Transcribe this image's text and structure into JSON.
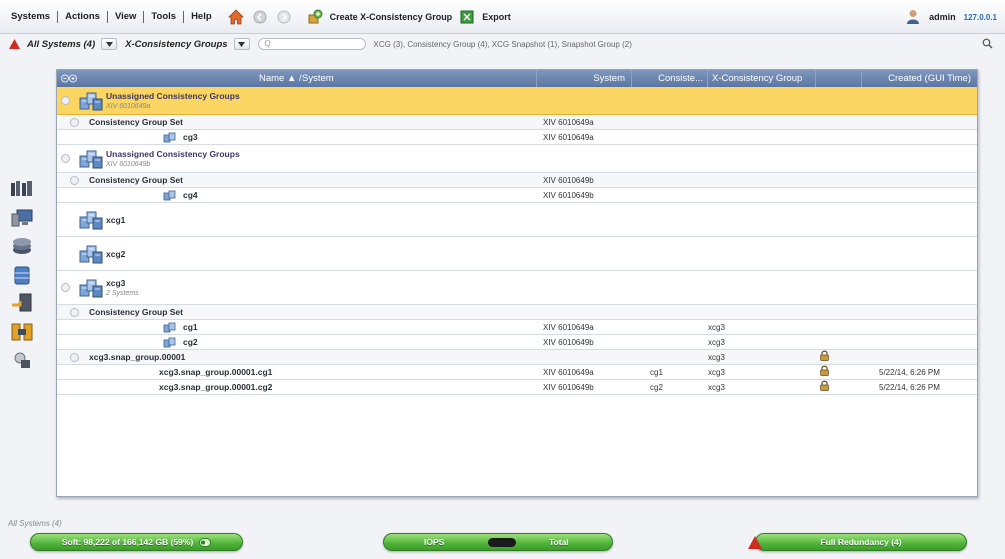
{
  "menu": {
    "items": [
      "Systems",
      "Actions",
      "View",
      "Tools",
      "Help"
    ],
    "create_xcg": "Create X-Consistency Group",
    "export": "Export",
    "user": "admin",
    "host": "127.0.0.1"
  },
  "filter": {
    "scope": "All Systems (4)",
    "view": "X-Consistency Groups",
    "search_value": "Q",
    "summary": "XCG (3), Consistency Group (4), XCG Snapshot (1), Snapshot Group (2)"
  },
  "grid": {
    "headers": {
      "name": "Name ▲ /",
      "system_inline": "System",
      "system": "System",
      "consistency": "Consiste...",
      "xcg": "X-Consistency Group",
      "created": "Created (GUI Time)"
    },
    "rows": [
      {
        "title": "Unassigned Consistency Groups",
        "subtitle": "XIV 6010649a"
      },
      {
        "title": "Consistency Group Set",
        "system": "XIV 6010649a"
      },
      {
        "title": "cg3",
        "system": "XIV 6010649a"
      },
      {
        "title": "Unassigned Consistency Groups",
        "subtitle": "XIV 6010649b"
      },
      {
        "title": "Consistency Group Set",
        "system": "XIV 6010649b"
      },
      {
        "title": "cg4",
        "system": "XIV 6010649b"
      },
      {
        "title": "xcg1"
      },
      {
        "title": "xcg2"
      },
      {
        "title": "xcg3",
        "subtitle": "2 Systems"
      },
      {
        "title": "Consistency Group Set"
      },
      {
        "title": "cg1",
        "system": "XIV 6010649a",
        "xcg": "xcg3"
      },
      {
        "title": "cg2",
        "system": "XIV 6010649b",
        "xcg": "xcg3"
      },
      {
        "title": "xcg3.snap_group.00001",
        "xcg": "xcg3"
      },
      {
        "title": "xcg3.snap_group.00001.cg1",
        "system": "XIV 6010649a",
        "consistency": "cg1",
        "xcg": "xcg3",
        "created": "5/22/14, 6:26 PM"
      },
      {
        "title": "xcg3.snap_group.00001.cg2",
        "system": "XIV 6010649b",
        "consistency": "cg2",
        "xcg": "xcg3",
        "created": "5/22/14, 6:26 PM"
      }
    ]
  },
  "status": {
    "label": "All Systems (4)",
    "soft": "Soft: 98,222 of 166,142 GB (59%)",
    "iops": "IOPS",
    "total": "Total",
    "redundancy": "Full Redundancy (4)"
  },
  "colors": {
    "header": "#6b84ae",
    "highlight": "#fbd562",
    "pill": "#4fb33a",
    "alert": "#d22b1f"
  }
}
